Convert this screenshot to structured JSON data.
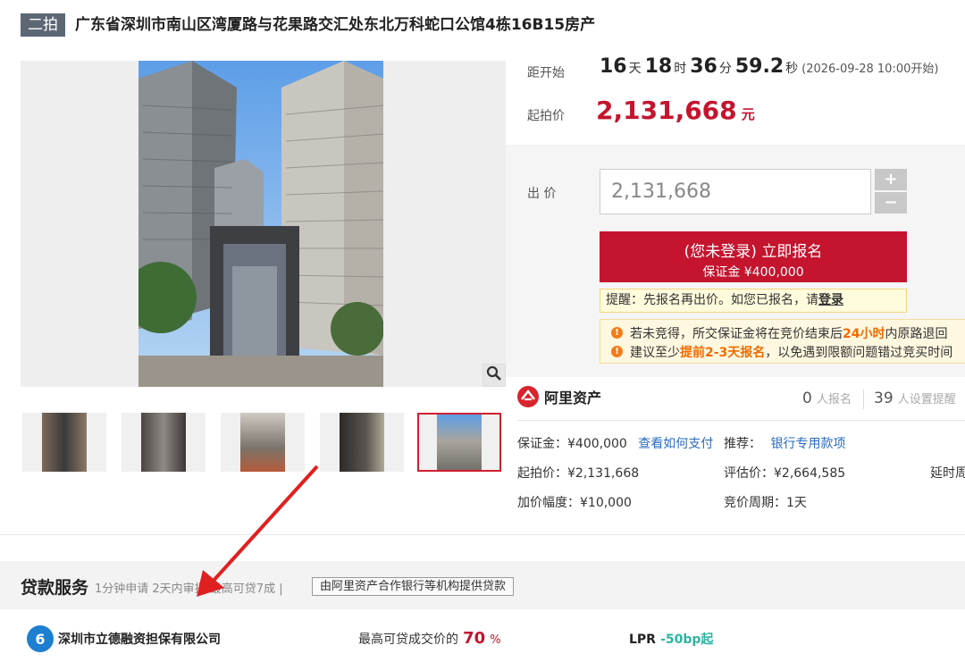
{
  "header": {
    "badge": "二拍",
    "title": "广东省深圳市南山区湾厦路与花果路交汇处东北万科蛇口公馆4栋16B15房产"
  },
  "countdown": {
    "label": "距开始",
    "days": "16",
    "days_unit": "天",
    "hours": "18",
    "hours_unit": "时",
    "minutes": "36",
    "minutes_unit": "分",
    "seconds": "59.2",
    "seconds_unit": "秒",
    "start_note": "(2026-09-28 10:00开始)"
  },
  "start_price": {
    "label": "起拍价",
    "value": "2,131,668",
    "unit": "元"
  },
  "bid": {
    "label": "出 价",
    "input_value": "2,131,668",
    "plus": "+",
    "minus": "−",
    "signup_main": "(您未登录) 立即报名",
    "signup_sub": "保证金 ¥400,000",
    "tip_text": "提醒：先报名再出价。如您已报名，请",
    "tip_link": "登录",
    "warn1_a": "若未竞得，所交保证金将在竞价结束后",
    "warn1_b": "24小时",
    "warn1_c": "内原路退回",
    "warn2_a": "建议至少",
    "warn2_b": "提前2-3天报名",
    "warn2_c": "，以免遇到限额问题错过竞买时间"
  },
  "platform": {
    "name": "阿里资产",
    "signups": "0",
    "signups_label": "人报名",
    "reminders": "39",
    "reminders_label": "人设置提醒"
  },
  "details": {
    "deposit": "保证金：¥400,000",
    "pay_link": "查看如何支付",
    "recommend": "推荐：",
    "bank_link": "银行专用款项",
    "start_price": "起拍价：¥2,131,668",
    "eval_price": "评估价：¥2,664,585",
    "delay": "延时周",
    "increment": "加价幅度：¥10,000",
    "cycle": "竞价周期：1天"
  },
  "loan": {
    "title": "贷款服务",
    "subtitle": "1分钟申请 2天内审批 最高可贷7成 |",
    "provider_note": "由阿里资产合作银行等机构提供贷款",
    "company": "深圳市立德融资担保有限公司",
    "ratio_label": "最高可贷成交价的",
    "ratio_value": "70",
    "ratio_unit": "%",
    "lpr_label": "LPR",
    "lpr_value": "-50bp起"
  },
  "colors": {
    "accent_red": "#c4142e",
    "badge_gray": "#5d6774",
    "link_blue": "#2a6cbf",
    "warn_orange": "#f26b00"
  }
}
